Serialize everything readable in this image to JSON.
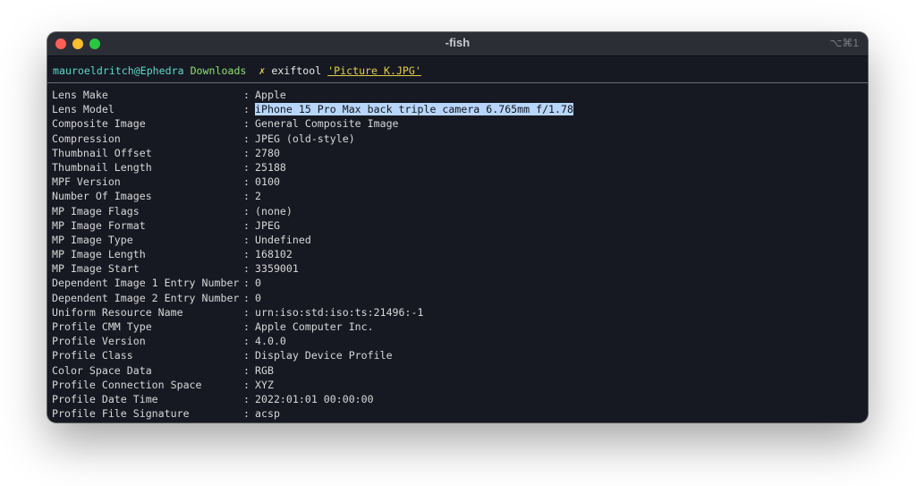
{
  "window": {
    "title": "-fish",
    "shortcut": "⌥⌘1"
  },
  "prompt": {
    "user_host": "mauroeldritch@Ephedra",
    "dir": "Downloads",
    "mark": "✗",
    "command": "exiftool",
    "argument": "'Picture K.JPG'"
  },
  "rows": [
    {
      "key": "Lens Make",
      "value": "Apple"
    },
    {
      "key": "Lens Model",
      "value": "iPhone 15 Pro Max back triple camera 6.765mm f/1.78",
      "selected": true
    },
    {
      "key": "Composite Image",
      "value": "General Composite Image"
    },
    {
      "key": "Compression",
      "value": "JPEG (old-style)"
    },
    {
      "key": "Thumbnail Offset",
      "value": "2780"
    },
    {
      "key": "Thumbnail Length",
      "value": "25188"
    },
    {
      "key": "MPF Version",
      "value": "0100"
    },
    {
      "key": "Number Of Images",
      "value": "2"
    },
    {
      "key": "MP Image Flags",
      "value": "(none)"
    },
    {
      "key": "MP Image Format",
      "value": "JPEG"
    },
    {
      "key": "MP Image Type",
      "value": "Undefined"
    },
    {
      "key": "MP Image Length",
      "value": "168102"
    },
    {
      "key": "MP Image Start",
      "value": "3359001"
    },
    {
      "key": "Dependent Image 1 Entry Number",
      "value": "0"
    },
    {
      "key": "Dependent Image 2 Entry Number",
      "value": "0"
    },
    {
      "key": "Uniform Resource Name",
      "value": "urn:iso:std:iso:ts:21496:-1"
    },
    {
      "key": "Profile CMM Type",
      "value": "Apple Computer Inc."
    },
    {
      "key": "Profile Version",
      "value": "4.0.0"
    },
    {
      "key": "Profile Class",
      "value": "Display Device Profile"
    },
    {
      "key": "Color Space Data",
      "value": "RGB"
    },
    {
      "key": "Profile Connection Space",
      "value": "XYZ"
    },
    {
      "key": "Profile Date Time",
      "value": "2022:01:01 00:00:00"
    },
    {
      "key": "Profile File Signature",
      "value": "acsp"
    }
  ]
}
